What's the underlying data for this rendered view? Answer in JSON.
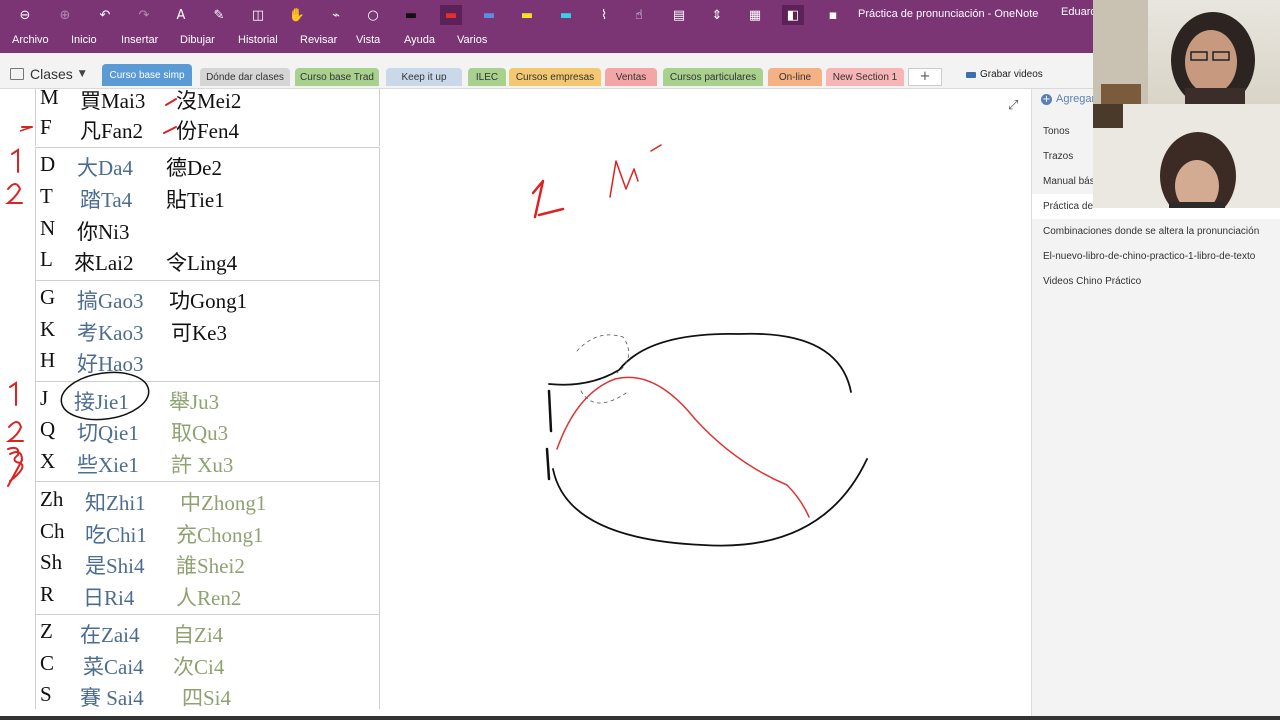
{
  "app": {
    "doc_title": "Práctica de pronunciación  -  OneNote",
    "user": "Eduard"
  },
  "menu": [
    "Archivo",
    "Inicio",
    "Insertar",
    "Dibujar",
    "Historial",
    "Revisar",
    "Vista",
    "Ayuda",
    "Varios"
  ],
  "toolbar_icons": [
    "back-icon",
    "forward-icon",
    "undo-icon",
    "redo-icon",
    "type-icon",
    "lasso-icon",
    "eraser-icon",
    "pan-icon",
    "lasso-select-icon",
    "shape-icon",
    "pen-black-icon",
    "pen-red-icon",
    "pen-blue-icon",
    "highlighter-yellow-icon",
    "highlighter-cyan-icon",
    "ruler-icon",
    "touch-draw-icon",
    "page-width-icon",
    "insert-space-icon",
    "fullscreen-icon",
    "dock-icon",
    "more-icon"
  ],
  "notebook": {
    "label": "Clases"
  },
  "sections": [
    {
      "label": "Curso base simp",
      "color": "#5b9bd5",
      "active": true
    },
    {
      "label": "Dónde dar clases",
      "color": "#d5d5d5"
    },
    {
      "label": "Curso base Trad",
      "color": "#a9d18e"
    },
    {
      "label": "Keep it up",
      "color": "#c9d9e9"
    },
    {
      "label": "ILEC",
      "color": "#a9d18e"
    },
    {
      "label": "Cursos empresas",
      "color": "#f4c870"
    },
    {
      "label": "Ventas",
      "color": "#f4a6a6"
    },
    {
      "label": "Cursos particulares",
      "color": "#a9d18e"
    },
    {
      "label": "On-line",
      "color": "#f4b183"
    },
    {
      "label": "New Section 1",
      "color": "#f7b5b5"
    }
  ],
  "add_section": "+",
  "record_label": "Grabar videos",
  "table": {
    "groups": [
      {
        "rows": [
          {
            "ini": "M",
            "w1": "買Mai3",
            "w2": "沒Mei2"
          },
          {
            "ini": "F",
            "w1": "凡Fan2",
            "w2": "份Fen4"
          }
        ]
      },
      {
        "rows": [
          {
            "ini": "D",
            "w1": "大Da4",
            "w2": "德De2"
          },
          {
            "ini": "T",
            "w1": "踏Ta4",
            "w2": "貼Tie1"
          },
          {
            "ini": "N",
            "w1": "你Ni3",
            "w2": ""
          },
          {
            "ini": "L",
            "w1": "來Lai2",
            "w2": "令Ling4"
          }
        ]
      },
      {
        "rows": [
          {
            "ini": "G",
            "w1": "搞Gao3",
            "w2": "功Gong1"
          },
          {
            "ini": "K",
            "w1": "考Kao3",
            "w2": "可Ke3"
          },
          {
            "ini": "H",
            "w1": "好Hao3",
            "w2": ""
          }
        ]
      },
      {
        "rows": [
          {
            "ini": "J",
            "w1": "接Jie1",
            "w2": "舉Ju3"
          },
          {
            "ini": "Q",
            "w1": "切Qie1",
            "w2": "取Qu3"
          },
          {
            "ini": "X",
            "w1": "些Xie1",
            "w2": "許 Xu3"
          }
        ]
      },
      {
        "rows": [
          {
            "ini": "Zh",
            "w1": "知Zhi1",
            "w2": "中Zhong1"
          },
          {
            "ini": "Ch",
            "w1": "吃Chi1",
            "w2": "充Chong1"
          },
          {
            "ini": "Sh",
            "w1": "是Shi4",
            "w2": "誰Shei2"
          },
          {
            "ini": "R",
            "w1": "日Ri4",
            "w2": "人Ren2"
          }
        ]
      },
      {
        "rows": [
          {
            "ini": "Z",
            "w1": "在Zai4",
            "w2": "自Zi4"
          },
          {
            "ini": "C",
            "w1": "菜Cai4",
            "w2": "次Ci4"
          },
          {
            "ini": "S",
            "w1": "賽 Sai4",
            "w2": "四Si4"
          }
        ]
      }
    ]
  },
  "pages_pane": {
    "add_label": "Agregar",
    "items": [
      "Tonos",
      "Trazos",
      "Manual bás",
      "Práctica de",
      "Combinaciones donde se altera la pronunciación",
      "El-nuevo-libro-de-chino-practico-1-libro-de-texto",
      "Videos Chino Práctico"
    ]
  }
}
